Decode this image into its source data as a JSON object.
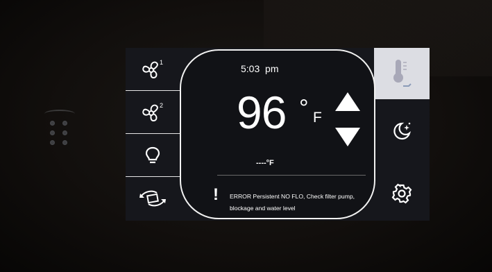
{
  "display": {
    "time": "5:03",
    "time_period": "pm",
    "current_temp": "96",
    "temp_unit": "F",
    "setpoint_display": "----°F",
    "error_message": "ERROR Persistent NO FLO, Check filter pump, blockage and water level",
    "error_symbol": "!"
  },
  "left_menu": {
    "pump1_superscript": "1",
    "pump2_superscript": "2"
  },
  "right_menu": {
    "heater_subtext": "——",
    "active_button_color": "#dcdde3"
  },
  "icons": {
    "pump1": "fan-icon",
    "pump2": "fan-icon",
    "light": "lightbulb-icon",
    "flip": "flip-arrows-icon",
    "heater": "thermometer-icon",
    "sleep": "moon-stars-icon",
    "settings": "gear-icon",
    "warning": "exclamation-icon",
    "temp_up": "arrow-up-icon",
    "temp_down": "arrow-down-icon"
  }
}
